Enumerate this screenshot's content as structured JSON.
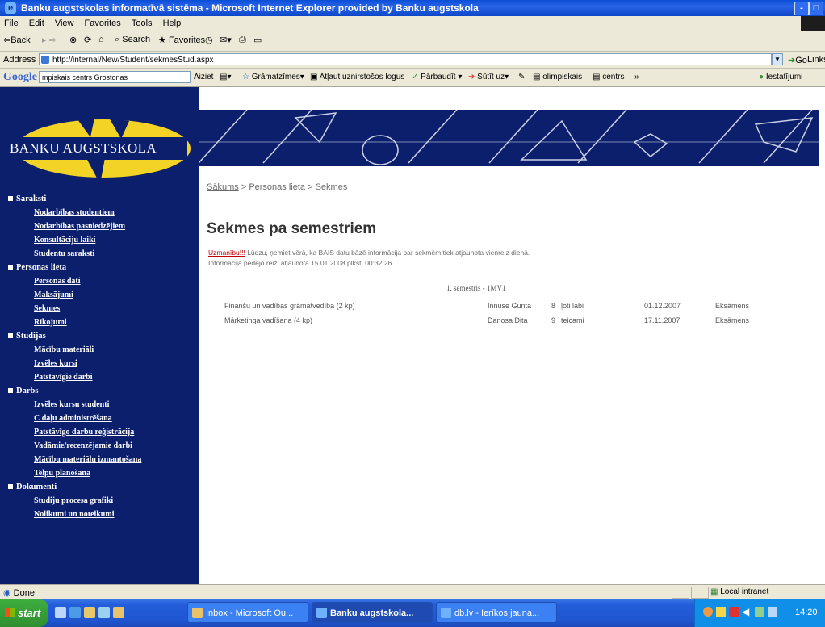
{
  "window": {
    "title": "Banku augstskolas informatīvā sistēma - Microsoft Internet Explorer provided by Banku augstskola",
    "minimize": "-",
    "maximize": "□"
  },
  "menu": [
    "File",
    "Edit",
    "View",
    "Favorites",
    "Tools",
    "Help"
  ],
  "toolbar": {
    "back": "⇦Back",
    "search": "Search",
    "favorites": "Favorites"
  },
  "address": {
    "label": "Address",
    "url": "http://internal/New/Student/sekmesStud.aspx",
    "go": "Go",
    "links": "Links"
  },
  "google_bar": {
    "logo": "Google",
    "search_value": "mpiskais centrs Grostonas",
    "items": [
      "Aiziet",
      "Grāmatzīmes",
      "Atļaut uznirstošos logus",
      "Pārbaudīt",
      "Sūtīt uz",
      "olimpiskais",
      "centrs",
      "Iestatījumi"
    ]
  },
  "logo": {
    "text": "BANKU AUGSTSKOLA",
    "accent": "#f3d326"
  },
  "sidebar": {
    "sections": [
      {
        "title": "Saraksti",
        "items": [
          "Nodarbības studentiem",
          "Nodarbības pasniedzējiem",
          "Konsultāciju laiki",
          "Studentu saraksti"
        ]
      },
      {
        "title": "Personas lieta",
        "items": [
          "Personas dati",
          "Maksājumi",
          "Sekmes",
          "Rīkojumi"
        ]
      },
      {
        "title": "Studijas",
        "items": [
          "Mācību materiāli",
          "Izvēles kursi",
          "Patstāvīgie darbi"
        ]
      },
      {
        "title": "Darbs",
        "items": [
          "Izvēles kursu studenti",
          "C daļu administrēšana",
          "Patstāvīgo darbu reģistrācija",
          "Vadāmie/recenzējamie darbi",
          "Mācību materiālu izmantošana",
          "Telpu plānošana"
        ]
      },
      {
        "title": "Dokumenti",
        "items": [
          "Studiju procesa grafiki",
          "Nolikumi un noteikumi"
        ]
      }
    ]
  },
  "breadcrumb": {
    "home": "Sākums",
    "sep": ">",
    "level2": "Personas lieta",
    "level3": "Sekmes"
  },
  "page": {
    "title": "Sekmes pa semestriem",
    "warning_prefix": "Uzmanību!!!",
    "warning_text": " Lūdzu, ņemiet vērā, ka BAIS datu bāzē informācija par sekmēm tiek atjaunota vienreiz dienā.",
    "updated": "Informācija pēdējo reizi atjaunota 15.01.2008 plkst. 00:32:26."
  },
  "semester": {
    "title": "1. semestris - 1MV1",
    "rows": [
      {
        "course": "Finanšu un vadības grāmatvedība (2 kp)",
        "teacher": "Innuse Gunta",
        "grade": "8",
        "grade_text": "ļoti labi",
        "date": "01.12.2007",
        "type": "Eksāmens"
      },
      {
        "course": "Mārketinga vadīšana (4 kp)",
        "teacher": "Danosa Dita",
        "grade": "9",
        "grade_text": "teicami",
        "date": "17.11.2007",
        "type": "Eksāmens"
      }
    ]
  },
  "status": {
    "text": "Done",
    "zone": "Local intranet"
  },
  "taskbar": {
    "start": "start",
    "buttons": [
      "Inbox - Microsoft Ou...",
      "Banku augstskola...",
      "db.lv - Ierīkos jauna..."
    ],
    "time": "14:20"
  }
}
